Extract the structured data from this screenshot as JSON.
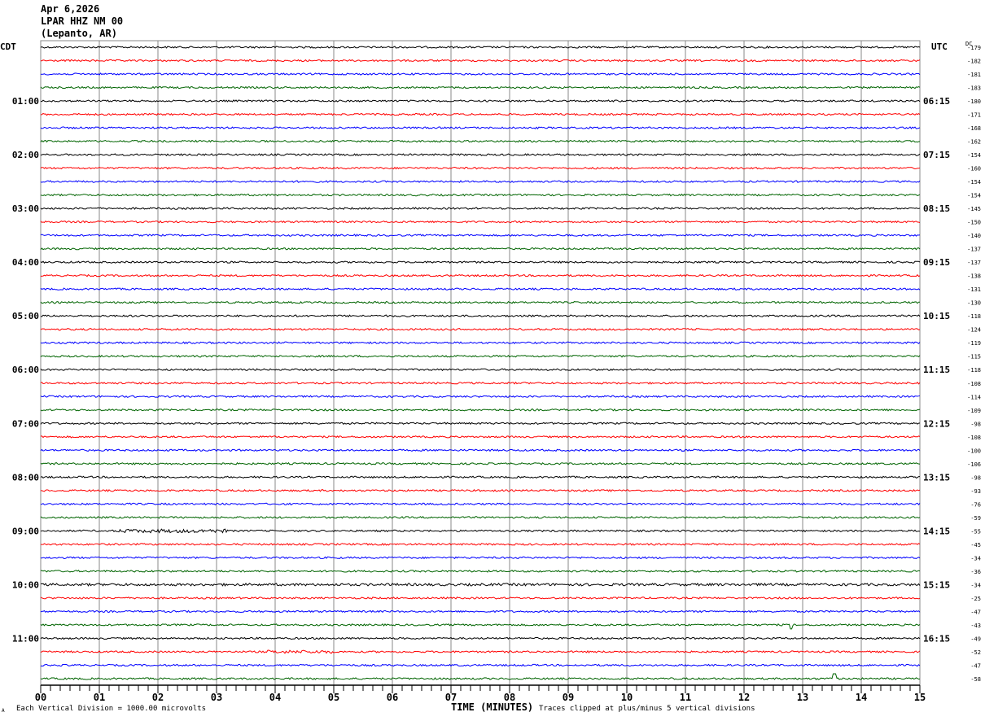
{
  "header": {
    "date": "Apr 6,2026",
    "station": "LPAR HHZ NM 00",
    "location": "(Lepanto, AR)"
  },
  "chart_data": {
    "type": "line",
    "subtype": "helicorder",
    "xlabel": "TIME (MINUTES)",
    "xlim": [
      0,
      15
    ],
    "x_ticks": [
      "00",
      "01",
      "02",
      "03",
      "04",
      "05",
      "06",
      "07",
      "08",
      "09",
      "10",
      "11",
      "12",
      "13",
      "14",
      "15"
    ],
    "left_axis_label": "CDT",
    "right_axis_label": "UTC",
    "dc_label": "DC",
    "left_hour_labels": [
      "01:00",
      "02:00",
      "03:00",
      "04:00",
      "05:00",
      "06:00",
      "07:00",
      "08:00",
      "09:00",
      "10:00",
      "11:00"
    ],
    "right_hour_labels": [
      "06:15",
      "07:15",
      "08:15",
      "09:15",
      "10:15",
      "11:15",
      "12:15",
      "13:15",
      "14:15",
      "15:15",
      "16:15"
    ],
    "trace_colors": [
      "#000000",
      "#ff0000",
      "#0000ff",
      "#006400"
    ],
    "dc_offsets": [
      -179,
      -182,
      -181,
      -183,
      -180,
      -171,
      -168,
      -162,
      -154,
      -160,
      -154,
      -154,
      -145,
      -150,
      -140,
      -137,
      -137,
      -138,
      -131,
      -130,
      -118,
      -124,
      -119,
      -115,
      -118,
      -108,
      -114,
      -109,
      -98,
      -108,
      -100,
      -106,
      -98,
      -93,
      -76,
      -59,
      -55,
      -45,
      -34,
      -36,
      -34,
      -25,
      -47,
      -43,
      -49,
      -52,
      -47,
      -58
    ],
    "scale_note": "Each Vertical Division = 1000.00 microvolts",
    "clip_note": "Traces clipped at plus/minus 5 vertical divisions"
  },
  "footer": {
    "corner_mark": "A"
  }
}
